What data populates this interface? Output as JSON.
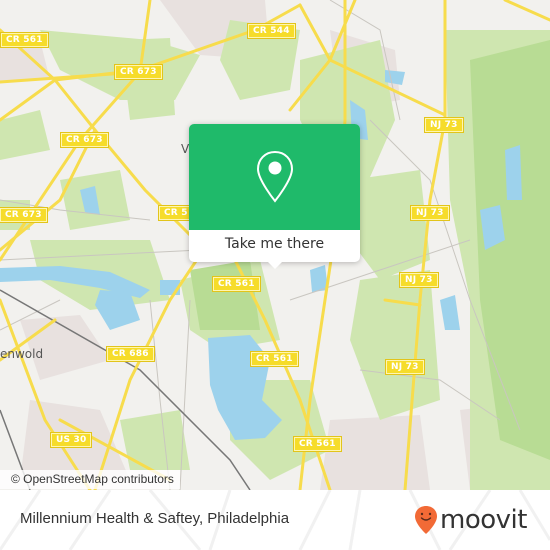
{
  "map": {
    "colors": {
      "land": "#f2f1ee",
      "park": "#cfe6b0",
      "forest": "#b8dc94",
      "water": "#9dd2ec",
      "urban": "#e8e1df",
      "road_major": "#f7dc4c",
      "road_minor": "#c9c6c0",
      "rail": "#777777"
    },
    "shields": [
      {
        "id": "cr561-nw",
        "label": "CR 561"
      },
      {
        "id": "cr544-n",
        "label": "CR 544"
      },
      {
        "id": "cr673-top",
        "label": "CR 673"
      },
      {
        "id": "cr673-mid",
        "label": "CR 673"
      },
      {
        "id": "cr673-left",
        "label": "CR 673"
      },
      {
        "id": "cr5-center",
        "label": "CR 5"
      },
      {
        "id": "cr561-center",
        "label": "CR 561"
      },
      {
        "id": "cr686",
        "label": "CR 686"
      },
      {
        "id": "cr561-south",
        "label": "CR 561"
      },
      {
        "id": "cr561-se",
        "label": "CR 561"
      },
      {
        "id": "us30",
        "label": "US 30"
      },
      {
        "id": "nj73-a",
        "label": "NJ 73"
      },
      {
        "id": "nj73-b",
        "label": "NJ 73"
      },
      {
        "id": "nj73-c",
        "label": "NJ 73"
      },
      {
        "id": "nj73-d",
        "label": "NJ 73"
      }
    ],
    "place_labels": [
      {
        "id": "town-v",
        "label": "V"
      },
      {
        "id": "town-enwold",
        "label": "enwold"
      }
    ],
    "attribution": "© OpenStreetMap contributors"
  },
  "popup": {
    "icon": "map-pin-icon",
    "action_label": "Take me there",
    "accent": "#1fba6a"
  },
  "footer": {
    "place_title": "Millennium Health & Saftey, Philadelphia",
    "brand": {
      "name": "moovit",
      "icon": "moovit-smiley-pin-icon",
      "accent": "#f26a36"
    }
  }
}
